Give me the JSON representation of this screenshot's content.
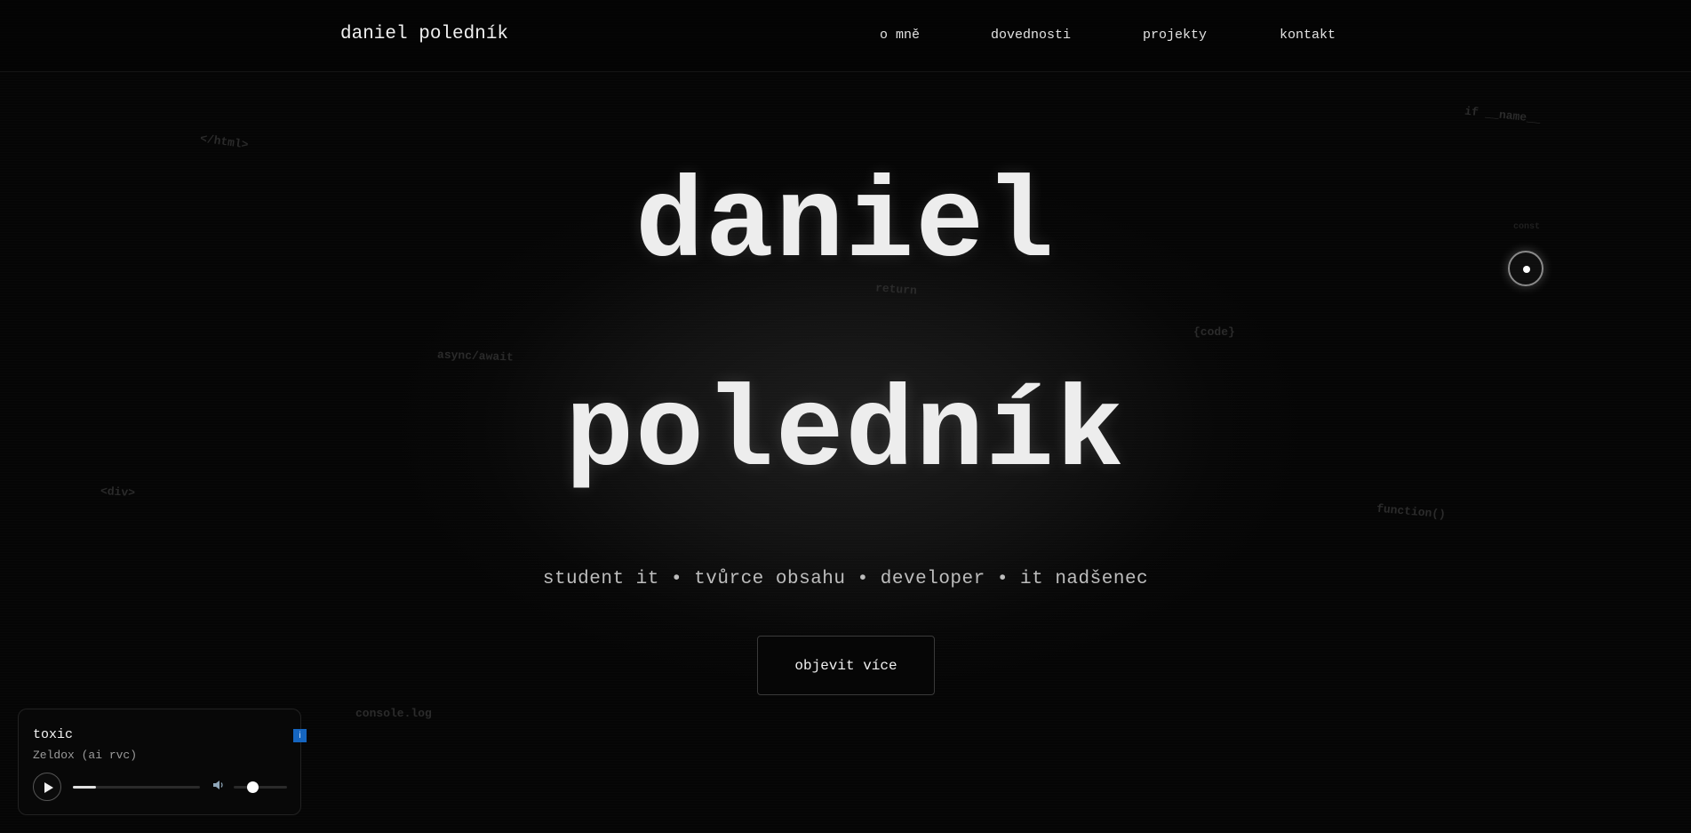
{
  "header": {
    "brand": "daniel poledník",
    "nav": [
      {
        "label": "o mně"
      },
      {
        "label": "dovednosti"
      },
      {
        "label": "projekty"
      },
      {
        "label": "kontakt"
      }
    ]
  },
  "hero": {
    "first_name": "daniel",
    "last_name": "poledník",
    "tagline": "student it • tvůrce obsahu • developer • it nadšenec",
    "cta_label": "objevit více"
  },
  "background_code": [
    "</html>",
    "if __name__",
    "return",
    "{code}",
    "async/await",
    "<div>",
    "function()",
    "console.log",
    "const"
  ],
  "player": {
    "title": "toxic",
    "artist": "Zeldox (ai rvc)",
    "info_badge": "i",
    "progress_percent": 18,
    "volume_percent": 35
  },
  "colors": {
    "background": "#050505",
    "text": "#ededed",
    "info_badge": "#1565c0"
  },
  "icons": {
    "play": "play-icon",
    "volume": "volume-icon",
    "cursor_orb": "cursor-orb-icon"
  }
}
